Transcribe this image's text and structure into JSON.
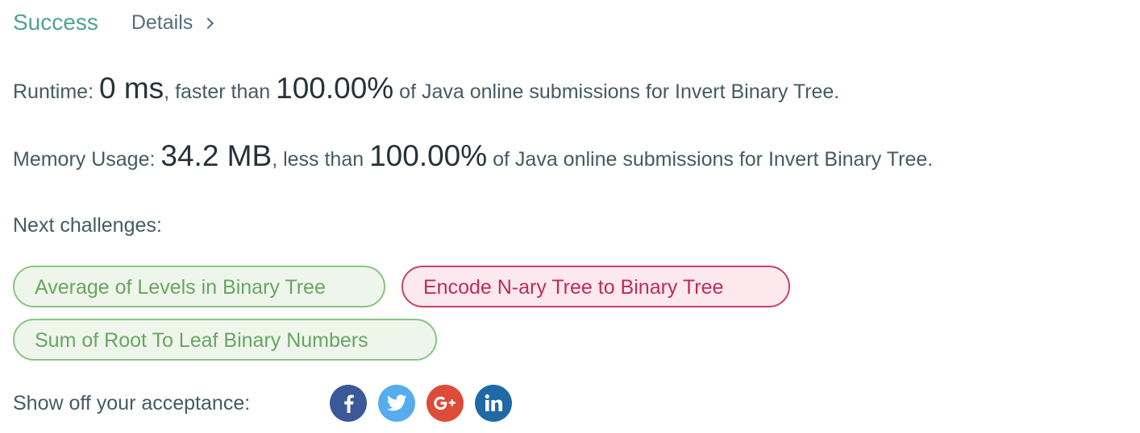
{
  "header": {
    "status": "Success",
    "details_label": "Details"
  },
  "runtime": {
    "label": "Runtime: ",
    "value": "0 ms",
    "comparison": ", faster than ",
    "percent": "100.00%",
    "suffix": " of Java online submissions for Invert Binary Tree."
  },
  "memory": {
    "label": "Memory Usage: ",
    "value": "34.2 MB",
    "comparison": ", less than ",
    "percent": "100.00%",
    "suffix": " of Java online submissions for Invert Binary Tree."
  },
  "next_challenges": {
    "label": "Next challenges:",
    "items": [
      {
        "label": "Average of Levels in Binary Tree",
        "difficulty": "easy"
      },
      {
        "label": "Encode N-ary Tree to Binary Tree",
        "difficulty": "hard"
      },
      {
        "label": "Sum of Root To Leaf Binary Numbers",
        "difficulty": "easy"
      }
    ]
  },
  "share": {
    "label": "Show off your acceptance:",
    "icons": [
      {
        "name": "facebook-icon",
        "color": "#3b5998"
      },
      {
        "name": "twitter-icon",
        "color": "#55acee"
      },
      {
        "name": "google-plus-icon",
        "color": "#dd4b39"
      },
      {
        "name": "linkedin-icon",
        "color": "#1f6aa5"
      }
    ]
  },
  "colors": {
    "success": "#4fa48e",
    "easy_border": "#8ac482",
    "easy_bg": "#eef6ec",
    "easy_text": "#6aa462",
    "hard_border": "#c6426b",
    "hard_bg": "#fbe9ee",
    "hard_text": "#c12a5a"
  }
}
